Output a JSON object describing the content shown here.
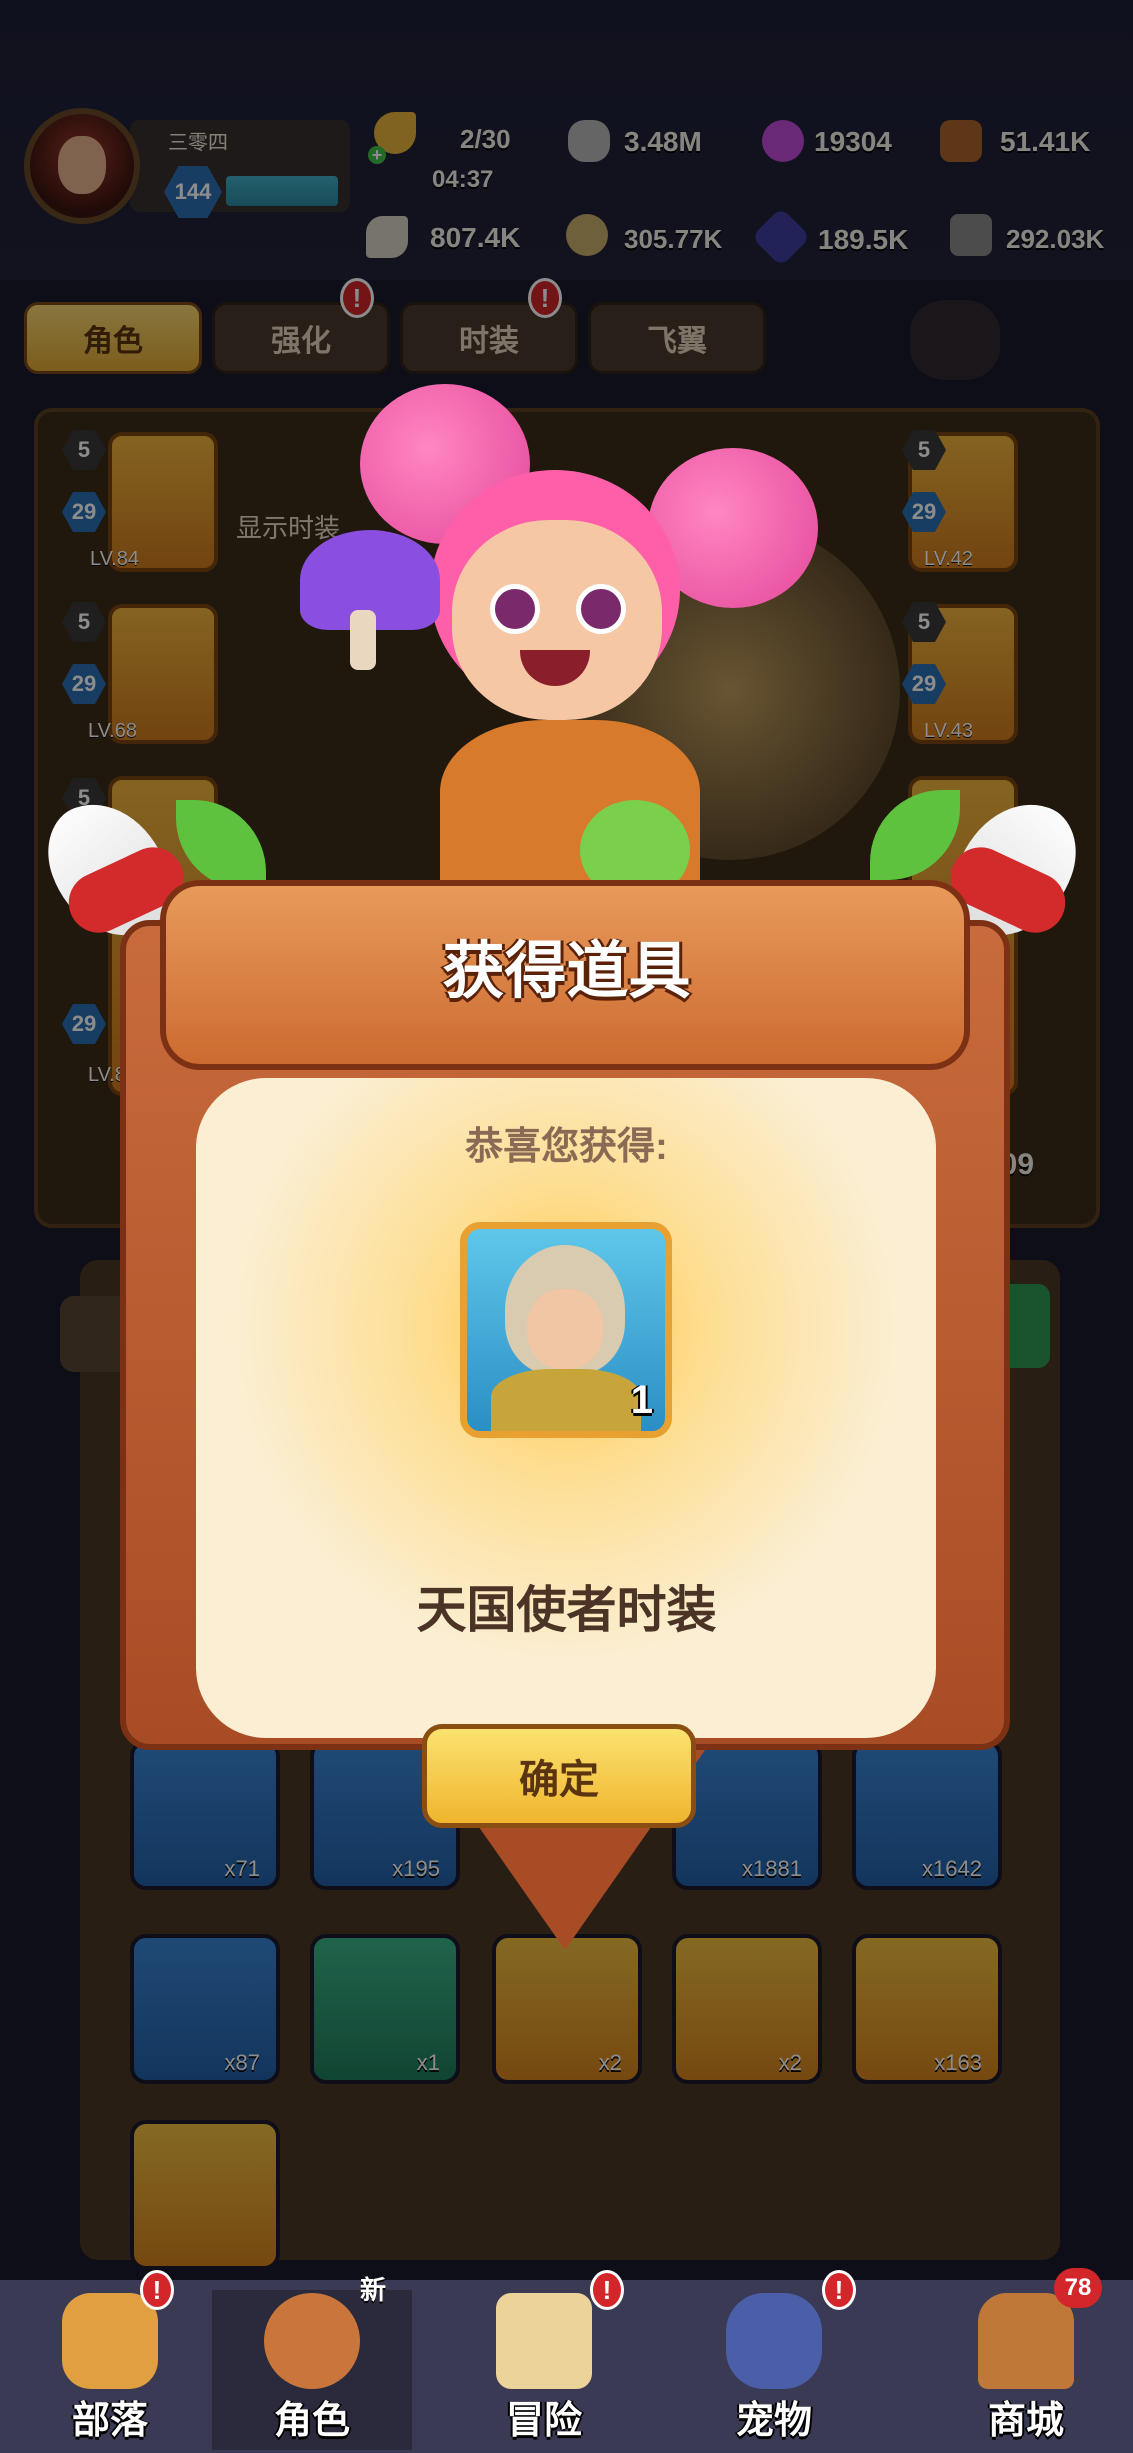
{
  "player": {
    "name": "三零四",
    "level": "144"
  },
  "energy": {
    "count": "2/30",
    "timer": "04:37"
  },
  "resources_top": [
    "3.48M",
    "19304",
    "51.41K"
  ],
  "resources_bottom": [
    "807.4K",
    "305.77K",
    "189.5K",
    "292.03K"
  ],
  "tabs": [
    {
      "label": "角色",
      "active": true,
      "alert": false
    },
    {
      "label": "强化",
      "active": false,
      "alert": true
    },
    {
      "label": "时装",
      "active": false,
      "alert": true
    },
    {
      "label": "飞翼",
      "active": false,
      "alert": false
    }
  ],
  "show_costume_label": "显示时装",
  "equipment": {
    "left": [
      {
        "star": "5",
        "rank": "29",
        "level": "LV.84"
      },
      {
        "star": "5",
        "rank": "29",
        "level": "LV.68"
      },
      {
        "star": "5",
        "rank": "29",
        "level": "LV.86"
      }
    ],
    "right": [
      {
        "star": "5",
        "rank": "29",
        "level": "LV.42"
      },
      {
        "star": "5",
        "rank": "29",
        "level": "LV.43"
      }
    ]
  },
  "power_partial": "409",
  "inventory": [
    {
      "qty": "x71",
      "color": "blue"
    },
    {
      "qty": "x195",
      "color": "blue"
    },
    {
      "qty": "x1881",
      "color": "blue"
    },
    {
      "qty": "x1642",
      "color": "blue"
    },
    {
      "qty": "x87",
      "color": "blue"
    },
    {
      "qty": "x1",
      "color": "green"
    },
    {
      "qty": "x2",
      "color": "gold"
    },
    {
      "qty": "x2",
      "color": "gold"
    },
    {
      "qty": "x163",
      "color": "gold"
    }
  ],
  "dialog": {
    "title": "获得道具",
    "congrats": "恭喜您获得:",
    "reward_qty": "1",
    "item_name": "天国使者时装",
    "confirm": "确定"
  },
  "nav": [
    {
      "label": "部落",
      "alert": true
    },
    {
      "label": "角色",
      "tag": "新",
      "active": true
    },
    {
      "label": "冒险",
      "alert": true
    },
    {
      "label": "宠物",
      "alert": true
    },
    {
      "label": "商城",
      "count": "78"
    }
  ],
  "colors": {
    "accent": "#f0b52e",
    "board": "#c86b3c",
    "alert": "#d2262b"
  }
}
